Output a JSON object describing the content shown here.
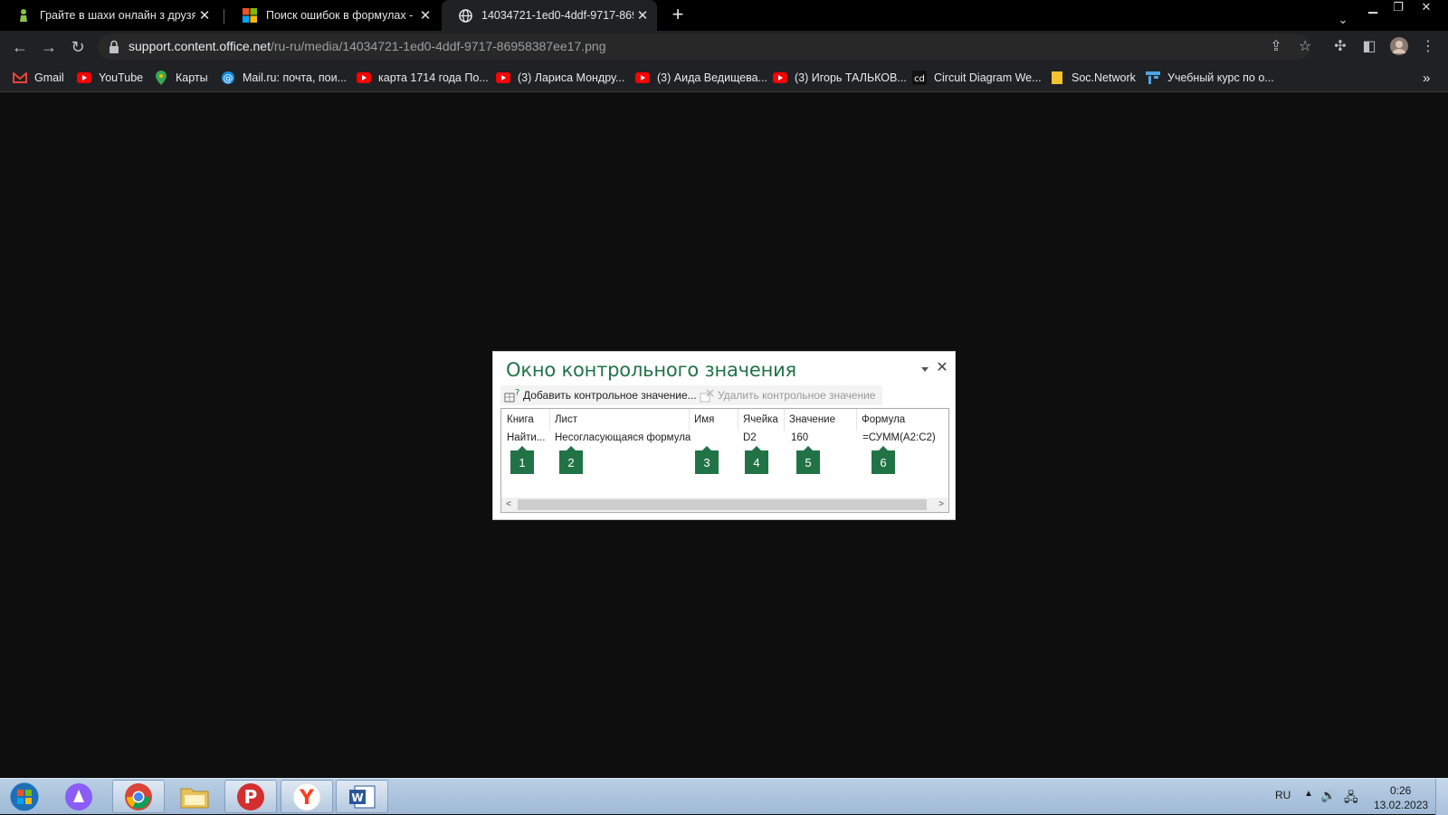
{
  "browser": {
    "tabs": [
      {
        "title": "Грайте в шахи онлайн з друзями",
        "close": "✕"
      },
      {
        "title": "Поиск ошибок в формулах - Сл",
        "close": "✕"
      },
      {
        "title": "14034721-1ed0-4ddf-9717-8695",
        "close": "✕"
      }
    ],
    "new_tab": "+",
    "url_host": "support.content.office.net",
    "url_path": "/ru-ru/media/14034721-1ed0-4ddf-9717-86958387ee17.png",
    "bookmarks": [
      {
        "label": "Gmail"
      },
      {
        "label": "YouTube"
      },
      {
        "label": "Карты"
      },
      {
        "label": "Mail.ru: почта, пои..."
      },
      {
        "label": "карта 1714 года По..."
      },
      {
        "label": "(3) Лариса Мондру..."
      },
      {
        "label": "(3) Аида Ведищева..."
      },
      {
        "label": "(3) Игорь ТАЛЬКОВ..."
      },
      {
        "label": "Circuit Diagram We..."
      },
      {
        "label": "Soc.Network"
      },
      {
        "label": "Учебный курс по о..."
      }
    ],
    "bookmarks_overflow": "»"
  },
  "watch_window": {
    "title": "Окно контрольного значения",
    "add_button": "Добавить контрольное значение...",
    "delete_button": "Удалить контрольное значение",
    "columns": [
      "Книга",
      "Лист",
      "Имя",
      "Ячейка",
      "Значение",
      "Формула"
    ],
    "row": [
      "Найти...",
      "Несогласующаяся формула",
      "",
      "D2",
      "160",
      "=СУММ(A2:C2)"
    ],
    "callouts": [
      "1",
      "2",
      "3",
      "4",
      "5",
      "6"
    ]
  },
  "taskbar": {
    "lang": "RU",
    "time": "0:26",
    "date": "13.02.2023"
  },
  "colors": {
    "excel_green": "#217346",
    "page_background": "#0e0e0e",
    "tab_strip": "#000000",
    "toolbar": "#202124"
  }
}
